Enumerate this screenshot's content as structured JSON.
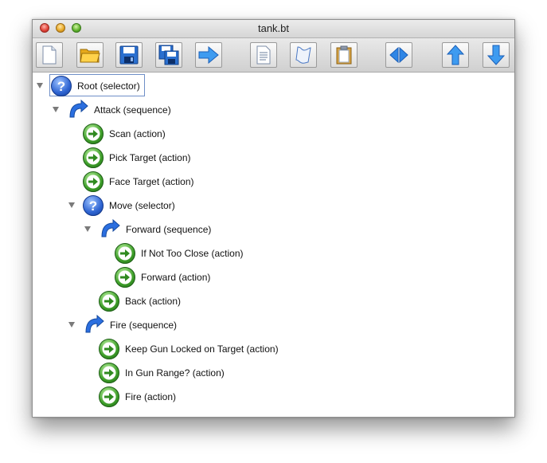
{
  "window": {
    "title": "tank.bt"
  },
  "toolbar": {
    "buttons": [
      {
        "name": "new-file-button",
        "icon": "new-file-icon"
      },
      {
        "name": "open-folder-button",
        "icon": "folder-icon"
      },
      {
        "name": "save-button",
        "icon": "floppy-disk-icon"
      },
      {
        "name": "save-all-button",
        "icon": "multi-floppy-icon"
      },
      {
        "name": "forward-button",
        "icon": "right-arrow-icon"
      },
      {
        "name": "document-button",
        "icon": "document-icon"
      },
      {
        "name": "script-button",
        "icon": "scroll-icon"
      },
      {
        "name": "clipboard-button",
        "icon": "clipboard-icon"
      },
      {
        "name": "expand-collapse-button",
        "icon": "left-right-arrow-icon"
      },
      {
        "name": "move-up-button",
        "icon": "up-arrow-icon"
      },
      {
        "name": "move-down-button",
        "icon": "down-arrow-icon"
      }
    ]
  },
  "tree": {
    "nodes": [
      {
        "label": "Root (selector)",
        "kind": "selector",
        "depth": 0,
        "expanded": true,
        "selected": true
      },
      {
        "label": "Attack (sequence)",
        "kind": "sequence",
        "depth": 1,
        "expanded": true
      },
      {
        "label": "Scan (action)",
        "kind": "action",
        "depth": 2
      },
      {
        "label": "Pick Target (action)",
        "kind": "action",
        "depth": 2
      },
      {
        "label": "Face Target (action)",
        "kind": "action",
        "depth": 2
      },
      {
        "label": "Move (selector)",
        "kind": "selector",
        "depth": 2,
        "expanded": true
      },
      {
        "label": "Forward (sequence)",
        "kind": "sequence",
        "depth": 3,
        "expanded": true
      },
      {
        "label": "If Not Too Close (action)",
        "kind": "action",
        "depth": 4
      },
      {
        "label": "Forward (action)",
        "kind": "action",
        "depth": 4
      },
      {
        "label": "Back (action)",
        "kind": "action",
        "depth": 3
      },
      {
        "label": "Fire (sequence)",
        "kind": "sequence",
        "depth": 2,
        "expanded": true
      },
      {
        "label": "Keep Gun Locked on Target (action)",
        "kind": "action",
        "depth": 3
      },
      {
        "label": "In Gun Range? (action)",
        "kind": "action",
        "depth": 3
      },
      {
        "label": "Fire (action)",
        "kind": "action",
        "depth": 3
      }
    ]
  },
  "colors": {
    "selector": "#2e64d2",
    "action": "#3f9f2a",
    "sequence": "#2b6fe0",
    "selection_border": "#6f8fc7"
  }
}
